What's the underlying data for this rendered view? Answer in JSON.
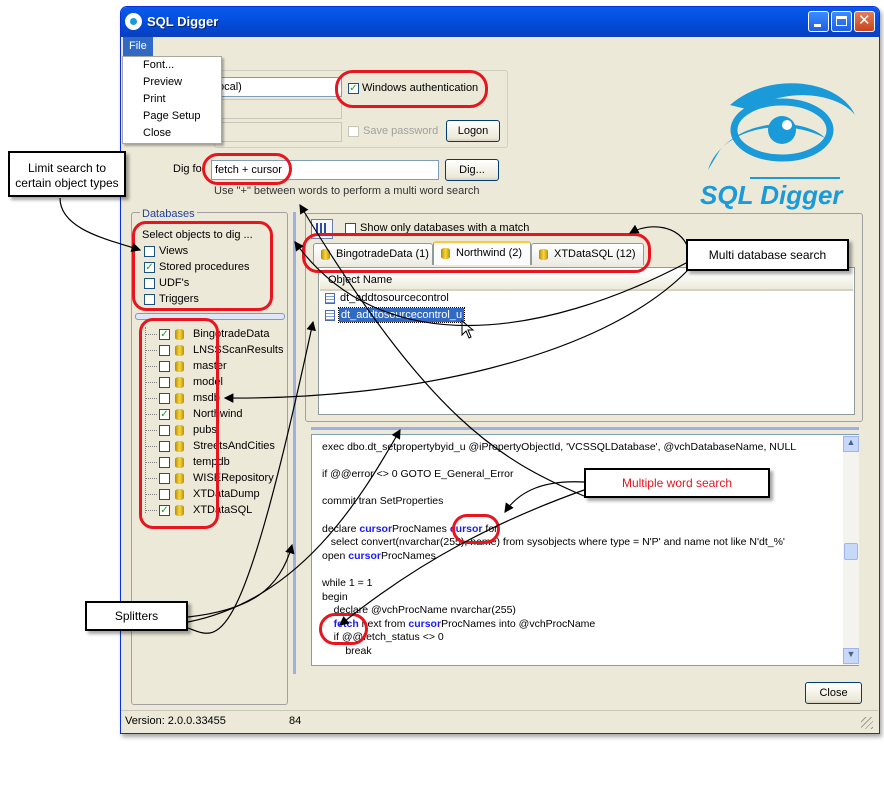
{
  "window": {
    "title": "SQL Digger"
  },
  "menu": {
    "file_label": "File",
    "items": [
      "Font...",
      "Preview",
      "Print",
      "Page Setup",
      "Close"
    ]
  },
  "connection": {
    "server_value": "ocal)",
    "windows_auth_label": "Windows authentication",
    "save_password_label": "Save password",
    "logon_button": "Logon",
    "dig_for_label": "Dig for",
    "search_value": "fetch + cursor",
    "dig_button": "Dig...",
    "hint": "Use \"+\" between words to perform a multi word search"
  },
  "logo": {
    "text": "SQL Digger"
  },
  "databases": {
    "group_label": "Databases",
    "object_types_label": "Select objects to dig ...",
    "object_types": [
      {
        "label": "Views",
        "checked": false
      },
      {
        "label": "Stored procedures",
        "checked": true
      },
      {
        "label": "UDF's",
        "checked": false
      },
      {
        "label": "Triggers",
        "checked": false
      }
    ],
    "list": [
      {
        "name": "BingotradeData",
        "checked": true
      },
      {
        "name": "LNSSScanResults",
        "checked": false
      },
      {
        "name": "master",
        "checked": false
      },
      {
        "name": "model",
        "checked": false
      },
      {
        "name": "msdb",
        "checked": false
      },
      {
        "name": "Northwind",
        "checked": true
      },
      {
        "name": "pubs",
        "checked": false
      },
      {
        "name": "StreetsAndCities",
        "checked": false
      },
      {
        "name": "tempdb",
        "checked": false
      },
      {
        "name": "WISERepository",
        "checked": false
      },
      {
        "name": "XTDataDump",
        "checked": false
      },
      {
        "name": "XTDataSQL",
        "checked": true
      }
    ]
  },
  "results": {
    "show_only_label": "Show only databases with a match",
    "tabs": [
      "BingotradeData (1)",
      "Northwind (2)",
      "XTDataSQL (12)"
    ],
    "column_header": "Object Name",
    "objects": [
      "dt_addtosourcecontrol",
      "dt_addtosourcecontrol_u"
    ]
  },
  "code_lines": [
    "exec dbo.dt_setpropertybyid_u @iPropertyObjectId, 'VCSSQLDatabase', @vchDatabaseName, NULL",
    "",
    "if @@error <> 0 GOTO E_General_Error",
    "",
    "commit tran SetProperties",
    "",
    "declare [cursor]ProcNames [cursor] for",
    "   select convert(nvarchar(255), name) from sysobjects where type = N'P' and name not like N'dt_%'",
    "open [cursor]ProcNames",
    "",
    "while 1 = 1",
    "begin",
    "    declare @vchProcName nvarchar(255)",
    "    [fetch] next from [cursor]ProcNames into @vchProcName",
    "    if @@fetch_status <> 0",
    "        break"
  ],
  "footer": {
    "close_button": "Close",
    "version": "Version: 2.0.0.33455",
    "count": "84"
  },
  "callouts": {
    "limit_search": "Limit search to certain object types",
    "multi_db": "Multi database search",
    "multi_word": "Multiple word search",
    "splitters": "Splitters"
  },
  "colors": {
    "titlebar": "#0453e4",
    "highlight": "#e8141e",
    "keyword": "#1a1aff",
    "logo": "#1a9ad8"
  }
}
